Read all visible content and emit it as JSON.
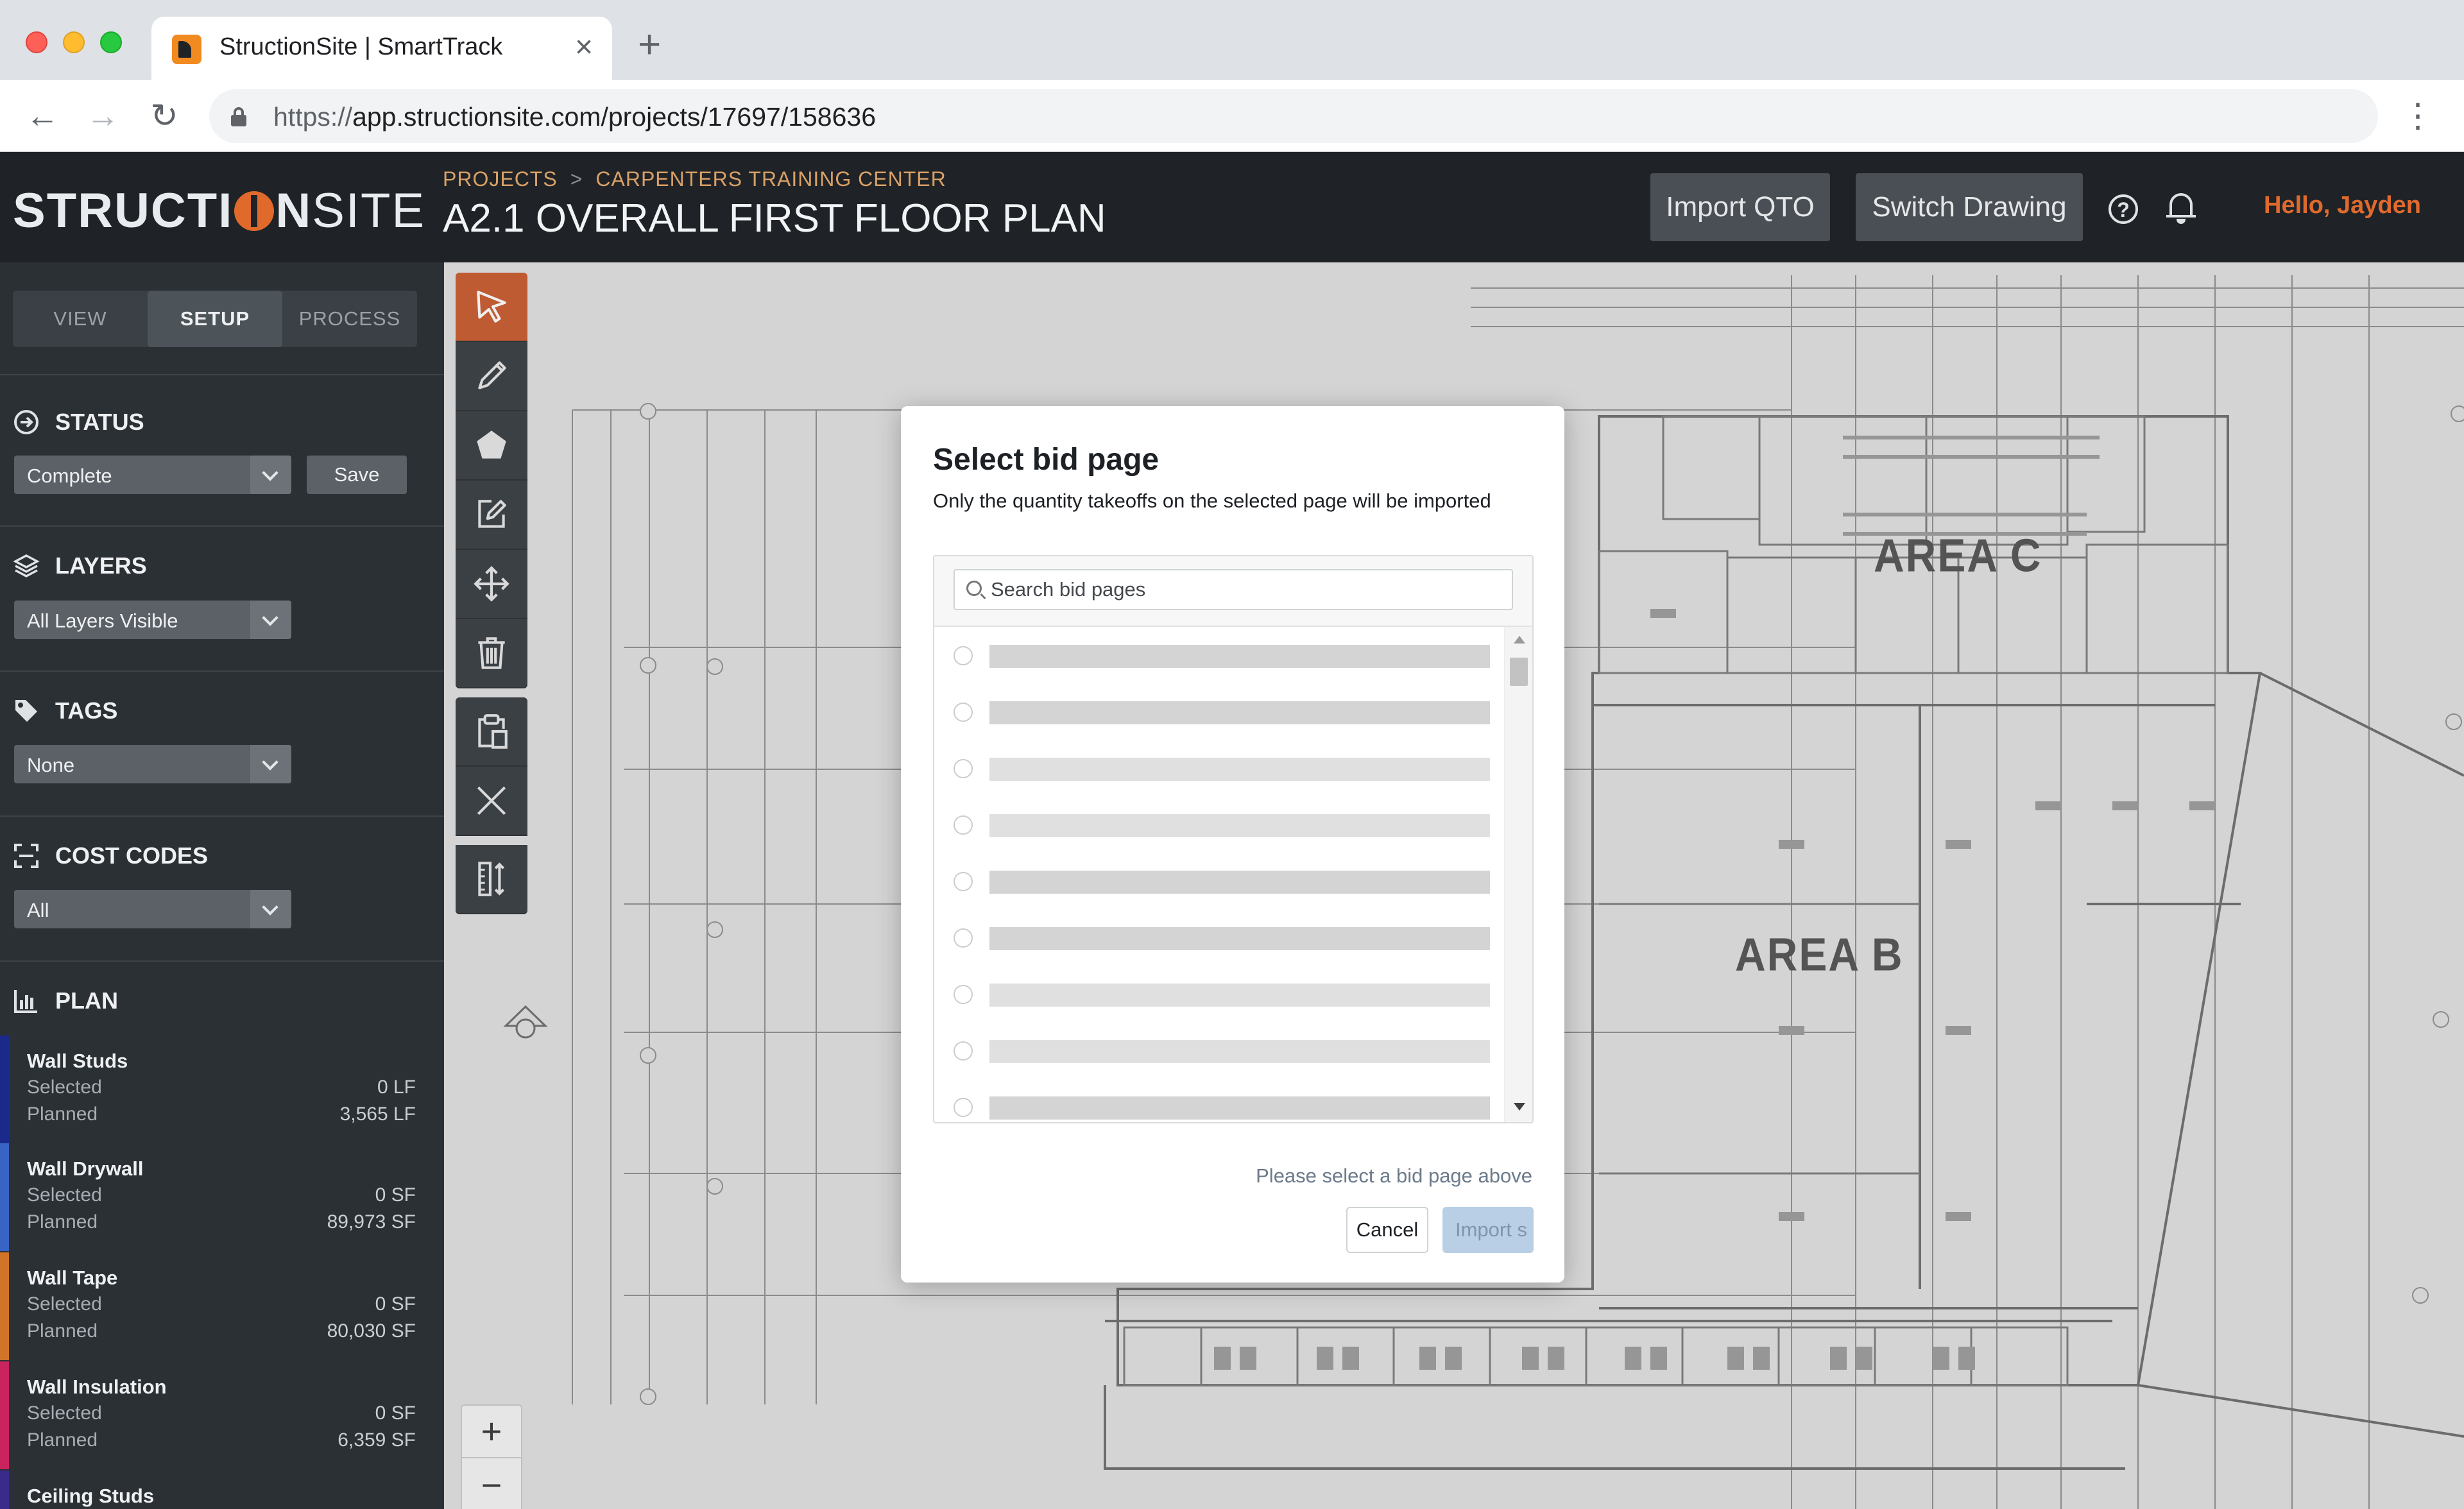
{
  "browser": {
    "tab_title": "StructionSite | SmartTrack",
    "tab_close": "×",
    "new_tab": "+",
    "url_scheme": "https://",
    "url_rest": "app.structionsite.com/projects/17697/158636",
    "back": "←",
    "forward": "→",
    "reload": "↻",
    "menu": "⋮"
  },
  "header": {
    "logo_a": "STRUCTI",
    "logo_b": "N",
    "logo_c": "SITE",
    "breadcrumb_root": "PROJECTS",
    "breadcrumb_sep": ">",
    "breadcrumb_project": "CARPENTERS TRAINING CENTER",
    "drawing_title": "A2.1 OVERALL FIRST FLOOR PLAN",
    "import_qto": "Import QTO",
    "switch_drawing": "Switch Drawing",
    "help": "?",
    "greeting": "Hello, Jayden"
  },
  "sidebar": {
    "tabs": [
      "VIEW",
      "SETUP",
      "PROCESS"
    ],
    "active_tab": "SETUP",
    "status": {
      "title": "STATUS",
      "value": "Complete",
      "save": "Save"
    },
    "layers": {
      "title": "LAYERS",
      "value": "All Layers Visible"
    },
    "tags": {
      "title": "TAGS",
      "value": "None"
    },
    "cost_codes": {
      "title": "COST CODES",
      "value": "All"
    },
    "plan": {
      "title": "PLAN",
      "selected_label": "Selected",
      "planned_label": "Planned",
      "items": [
        {
          "name": "Wall Studs",
          "selected": "0 LF",
          "planned": "3,565 LF",
          "color": "#1b2a8a"
        },
        {
          "name": "Wall Drywall",
          "selected": "0 SF",
          "planned": "89,973 SF",
          "color": "#3a64c4"
        },
        {
          "name": "Wall Tape",
          "selected": "0 SF",
          "planned": "80,030 SF",
          "color": "#d0742a"
        },
        {
          "name": "Wall Insulation",
          "selected": "0 SF",
          "planned": "6,359 SF",
          "color": "#c9245e"
        },
        {
          "name": "Ceiling Studs",
          "selected": "",
          "planned": "",
          "color": "#3a2a8a"
        }
      ]
    }
  },
  "canvas": {
    "area_b": "AREA B",
    "area_c": "AREA C",
    "zoom_in": "+",
    "zoom_out": "−"
  },
  "modal": {
    "title": "Select bid page",
    "subtitle": "Only the quantity takeoffs on the selected page will be imported",
    "search_placeholder": "Search bid pages",
    "hint": "Please select a bid page above",
    "cancel": "Cancel",
    "import": "Import s"
  },
  "colors": {
    "accent": "#e06a2c",
    "active_tool": "#c9572a",
    "header_bg": "#1f2327",
    "sidebar_bg": "#2b3035"
  }
}
